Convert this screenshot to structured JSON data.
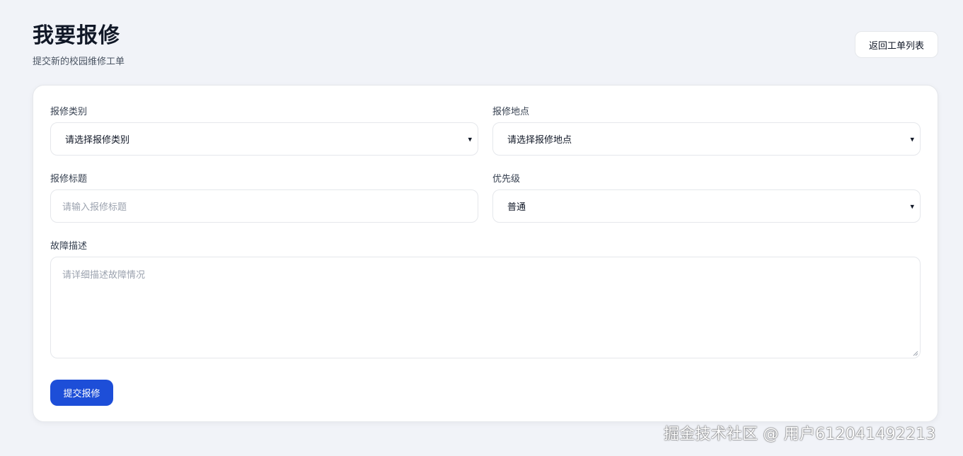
{
  "header": {
    "title": "我要报修",
    "subtitle": "提交新的校园维修工单",
    "back_label": "返回工单列表"
  },
  "form": {
    "category": {
      "label": "报修类别",
      "value": "请选择报修类别"
    },
    "location": {
      "label": "报修地点",
      "value": "请选择报修地点"
    },
    "title": {
      "label": "报修标题",
      "placeholder": "请输入报修标题"
    },
    "priority": {
      "label": "优先级",
      "value": "普通"
    },
    "description": {
      "label": "故障描述",
      "placeholder": "请详细描述故障情况"
    },
    "submit_label": "提交报修"
  },
  "watermark": "掘金技术社区 @ 用户612041492213",
  "colors": {
    "background": "#f1f3f8",
    "primary": "#1d4ed8",
    "card": "#ffffff"
  }
}
